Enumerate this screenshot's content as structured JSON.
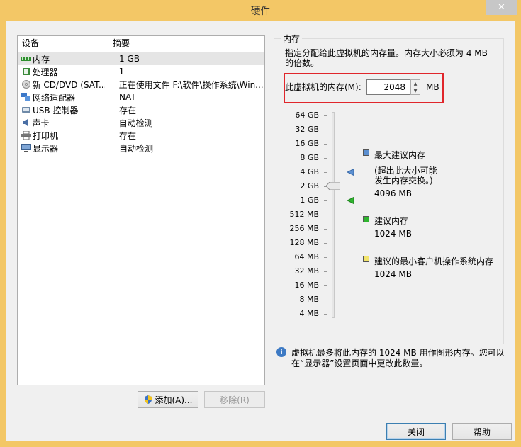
{
  "window": {
    "title": "硬件",
    "close_symbol": "✕"
  },
  "device_list": {
    "headers": {
      "device": "设备",
      "summary": "摘要"
    },
    "items": [
      {
        "name": "内存",
        "summary": "1 GB",
        "icon": "memory-icon",
        "selected": true
      },
      {
        "name": "处理器",
        "summary": "1",
        "icon": "processor-icon"
      },
      {
        "name": "新 CD/DVD (SAT...",
        "summary": "正在使用文件 F:\\软件\\操作系统\\Win...",
        "icon": "cd-dvd-icon"
      },
      {
        "name": "网络适配器",
        "summary": "NAT",
        "icon": "network-adapter-icon"
      },
      {
        "name": "USB 控制器",
        "summary": "存在",
        "icon": "usb-icon"
      },
      {
        "name": "声卡",
        "summary": "自动检测",
        "icon": "sound-card-icon"
      },
      {
        "name": "打印机",
        "summary": "存在",
        "icon": "printer-icon"
      },
      {
        "name": "显示器",
        "summary": "自动检测",
        "icon": "monitor-icon"
      }
    ],
    "add_button": "添加(A)...",
    "remove_button": "移除(R)"
  },
  "memory": {
    "group_title": "内存",
    "description": "指定分配给此虚拟机的内存量。内存大小必须为 4 MB 的倍数。",
    "field_label": "此虚拟机的内存(M):",
    "value": "2048",
    "unit": "MB",
    "slider_level": "2 GB",
    "scale_labels": [
      "64 GB",
      "32 GB",
      "16 GB",
      "8 GB",
      "4 GB",
      "2 GB",
      "1 GB",
      "512 MB",
      "256 MB",
      "128 MB",
      "64 MB",
      "32 MB",
      "16 MB",
      "8 MB",
      "4 MB"
    ],
    "legend": {
      "max": {
        "title": "最大建议内存",
        "note_line1": "(超出此大小可能",
        "note_line2": "发生内存交换。)",
        "value": "4096 MB",
        "color": "#5b8fd1"
      },
      "recommended": {
        "title": "建议内存",
        "value": "1024 MB",
        "color": "#2fb52f"
      },
      "min": {
        "title": "建议的最小客户机操作系统内存",
        "value": "1024 MB",
        "color": "#f2e46b"
      }
    },
    "info_text_line1": "虚拟机最多将此内存的 1024 MB 用作图形内存。您可以",
    "info_text_line2": "在“显示器”设置页面中更改此数量。"
  },
  "footer": {
    "close_button": "关闭",
    "help_button": "帮助"
  },
  "colors": {
    "title_bar": "#f3c766",
    "highlight_box": "#e0262b"
  }
}
